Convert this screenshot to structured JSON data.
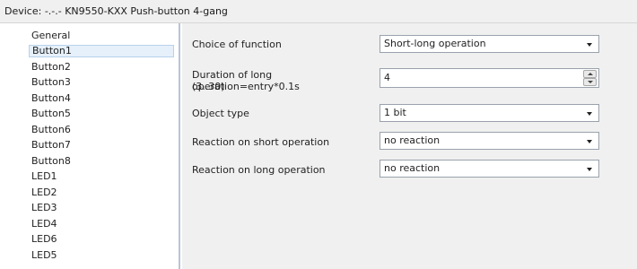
{
  "window": {
    "title": "Device: -.-.-  KN9550-KXX Push-button 4-gang"
  },
  "sidebar": {
    "items": [
      {
        "label": "General",
        "selected": false
      },
      {
        "label": "Button1",
        "selected": true
      },
      {
        "label": "Button2",
        "selected": false
      },
      {
        "label": "Button3",
        "selected": false
      },
      {
        "label": "Button4",
        "selected": false
      },
      {
        "label": "Button5",
        "selected": false
      },
      {
        "label": "Button6",
        "selected": false
      },
      {
        "label": "Button7",
        "selected": false
      },
      {
        "label": "Button8",
        "selected": false
      },
      {
        "label": "LED1",
        "selected": false
      },
      {
        "label": "LED2",
        "selected": false
      },
      {
        "label": "LED3",
        "selected": false
      },
      {
        "label": "LED4",
        "selected": false
      },
      {
        "label": "LED6",
        "selected": false
      },
      {
        "label": "LED5",
        "selected": false
      }
    ]
  },
  "params": {
    "choice_of_function": {
      "label": "Choice of function",
      "value": "Short-long operation",
      "icon": "chevron-down-icon"
    },
    "duration": {
      "label": "Duration of long operation=entry*0.1s",
      "range": "(3..30)",
      "value": "4",
      "icon": "spin-arrows-icon"
    },
    "object_type": {
      "label": "Object type",
      "value": "1 bit",
      "icon": "chevron-down-icon"
    },
    "short_reaction": {
      "label": "Reaction on short operation",
      "value": "no reaction",
      "icon": "chevron-down-icon"
    },
    "long_reaction": {
      "label": "Reaction on long operation",
      "value": "no reaction",
      "icon": "chevron-down-icon"
    }
  },
  "colors": {
    "panel_background": "#f0f0f0",
    "selection_background": "#e6f0fa",
    "selection_border": "#b7d1ec",
    "divider": "#b8c4d6"
  }
}
